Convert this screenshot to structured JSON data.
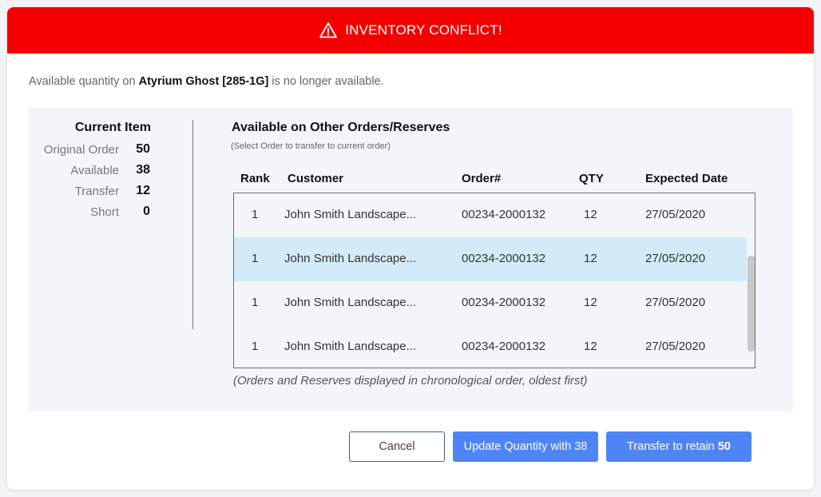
{
  "header": {
    "title": "INVENTORY CONFLICT!",
    "icon": "warning-triangle-icon",
    "color": "#f50000"
  },
  "message": {
    "prefix": "Available quantity on",
    "item": "Atyrium Ghost [285-1G]",
    "suffix": "is no longer available."
  },
  "current_item": {
    "title": "Current Item",
    "rows": [
      {
        "label": "Original Order",
        "value": "50"
      },
      {
        "label": "Available",
        "value": "38"
      },
      {
        "label": "Transfer",
        "value": "12"
      },
      {
        "label": "Short",
        "value": "0"
      }
    ]
  },
  "other_orders": {
    "title": "Available on Other Orders/Reserves",
    "subtitle": "(Select Order to transfer to current order)",
    "columns": [
      "Rank",
      "Customer",
      "Order#",
      "QTY",
      "Expected Date"
    ],
    "rows": [
      {
        "rank": "1",
        "customer": "John Smith Landscape...",
        "order": "00234-2000132",
        "qty": "12",
        "date": "27/05/2020"
      },
      {
        "rank": "1",
        "customer": "John Smith Landscape...",
        "order": "00234-2000132",
        "qty": "12",
        "date": "27/05/2020"
      },
      {
        "rank": "1",
        "customer": "John Smith Landscape...",
        "order": "00234-2000132",
        "qty": "12",
        "date": "27/05/2020"
      },
      {
        "rank": "1",
        "customer": "John Smith Landscape...",
        "order": "00234-2000132",
        "qty": "12",
        "date": "27/05/2020"
      }
    ],
    "selected_row_index": 1,
    "selected_color": "#d3ebf9",
    "footnote": "(Orders and Reserves displayed in chronological order, oldest first)"
  },
  "buttons": {
    "cancel": "Cancel",
    "update": "Update Quantity with 38",
    "transfer_prefix": "Transfer to retain",
    "transfer_value": "50",
    "accent": "#4f84f4"
  }
}
